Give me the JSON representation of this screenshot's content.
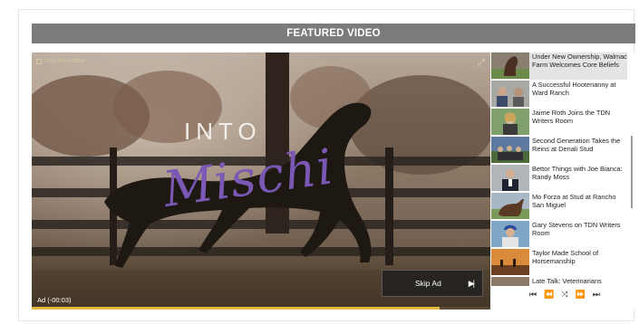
{
  "header": {
    "title": "FEATURED VIDEO"
  },
  "player": {
    "visit_advertiser": "Visit Advertiser",
    "ad_title_line1": "INTO",
    "ad_title_line2": "Mischi",
    "ad_countdown": "Ad (-00:03)",
    "skip_label": "Skip Ad",
    "progress_fraction": 0.89,
    "accent_color": "#e2b73c",
    "script_color": "#7a58b3"
  },
  "playlist": {
    "items": [
      {
        "title": "Under New Ownership, Walmac Farm Welcomes Core Beliefs",
        "thumb": "horse-portrait"
      },
      {
        "title": "A Successful Hootenanny at Ward Ranch",
        "thumb": "people-event"
      },
      {
        "title": "Jaime Roth Joins the TDN Writers Room",
        "thumb": "woman-outdoors"
      },
      {
        "title": "Second Generation Takes the Reins at Denali Stud",
        "thumb": "farm-group"
      },
      {
        "title": "Bettor Things with Joe Bianca: Randy Moss",
        "thumb": "man-suit"
      },
      {
        "title": "Mo Forza at Stud at Rancho San Miguel",
        "thumb": "horse-stud"
      },
      {
        "title": "Gary Stevens on TDN Writers Room",
        "thumb": "jockey-helmet"
      },
      {
        "title": "Taylor Made School of Horsemanship",
        "thumb": "sunset-riders"
      },
      {
        "title": "Late Talk: Veterinarians",
        "thumb": "partial"
      }
    ],
    "controls": {
      "first": "first-icon",
      "prev": "previous-icon",
      "shuffle": "shuffle-icon",
      "next": "next-icon",
      "last": "last-icon"
    }
  }
}
